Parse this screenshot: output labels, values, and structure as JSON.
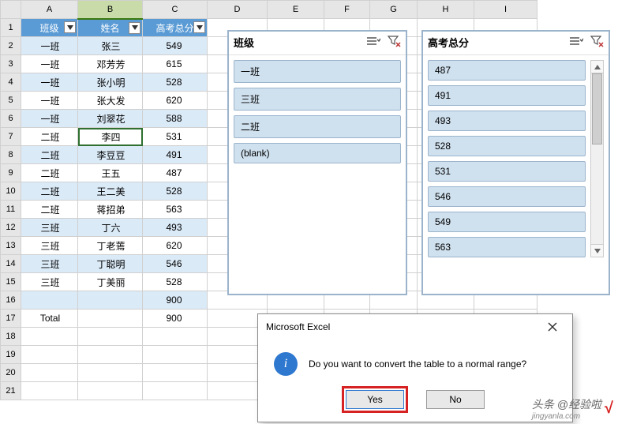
{
  "columns": [
    "A",
    "B",
    "C",
    "D",
    "E",
    "F",
    "G",
    "H",
    "I"
  ],
  "row_count": 21,
  "selected_cell": "B7",
  "selected_col": "B",
  "table": {
    "headers": [
      "班级",
      "姓名",
      "高考总分"
    ],
    "rows": [
      {
        "c": "一班",
        "n": "张三",
        "s": 549
      },
      {
        "c": "一班",
        "n": "邓芳芳",
        "s": 615
      },
      {
        "c": "一班",
        "n": "张小明",
        "s": 528
      },
      {
        "c": "一班",
        "n": "张大发",
        "s": 620
      },
      {
        "c": "一班",
        "n": "刘翠花",
        "s": 588
      },
      {
        "c": "二班",
        "n": "李四",
        "s": 531
      },
      {
        "c": "二班",
        "n": "李豆豆",
        "s": 491
      },
      {
        "c": "二班",
        "n": "王五",
        "s": 487
      },
      {
        "c": "二班",
        "n": "王二美",
        "s": 528
      },
      {
        "c": "二班",
        "n": "蒋招弟",
        "s": 563
      },
      {
        "c": "三班",
        "n": "丁六",
        "s": 493
      },
      {
        "c": "三班",
        "n": "丁老蔫",
        "s": 620
      },
      {
        "c": "三班",
        "n": "丁聪明",
        "s": 546
      },
      {
        "c": "三班",
        "n": "丁美丽",
        "s": 528
      }
    ],
    "subtotal_row": {
      "col_c_value": 900
    },
    "total_row": {
      "label": "Total",
      "value": 900
    }
  },
  "slicer1": {
    "title": "班级",
    "items": [
      "一班",
      "三班",
      "二班",
      "(blank)"
    ]
  },
  "slicer2": {
    "title": "高考总分",
    "items": [
      "487",
      "491",
      "493",
      "528",
      "531",
      "546",
      "549",
      "563"
    ]
  },
  "dialog": {
    "title": "Microsoft Excel",
    "message": "Do you want to convert the table to a normal range?",
    "yes": "Yes",
    "no": "No"
  },
  "watermark": {
    "line1": "头条 @经验啦",
    "line2": "jingyanla.com"
  }
}
